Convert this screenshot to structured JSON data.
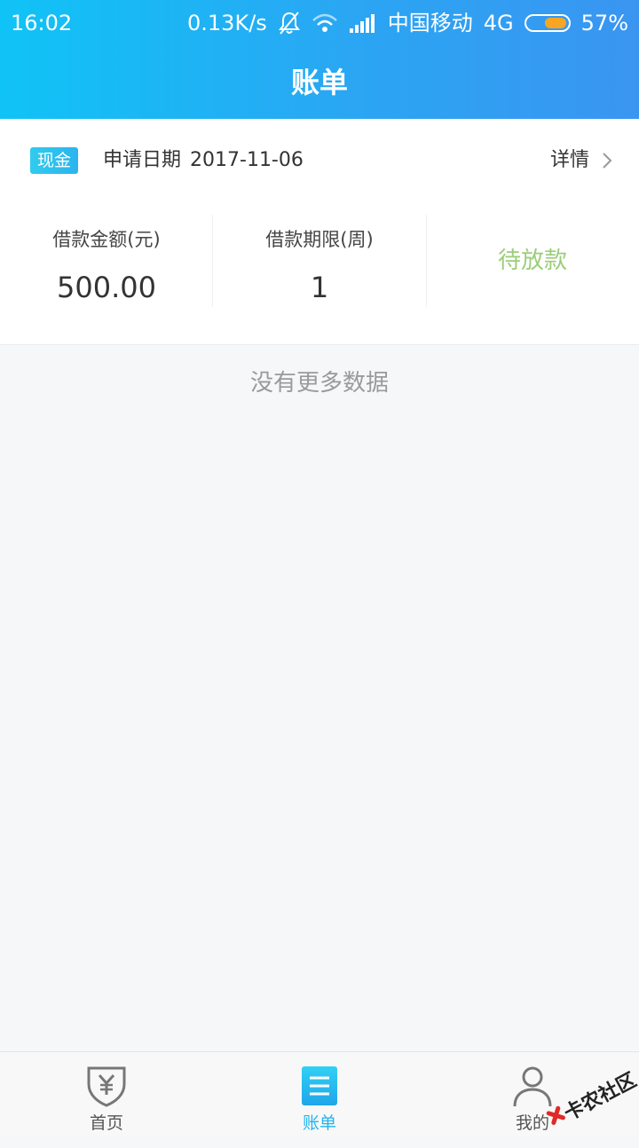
{
  "status_bar": {
    "time": "16:02",
    "net_speed": "0.13K/s",
    "carrier": "中国移动",
    "network": "4G",
    "battery_percent": "57%",
    "battery_level": 0.57,
    "icons": [
      "bell-off-icon",
      "wifi-icon",
      "signal-icon",
      "battery-icon"
    ]
  },
  "header": {
    "title": "账单"
  },
  "bill": {
    "tag": "现金",
    "apply_date_label": "申请日期",
    "apply_date": "2017-11-06",
    "detail_label": "详情",
    "amount_label": "借款金额(元)",
    "amount_value": "500.00",
    "term_label": "借款期限(周)",
    "term_value": "1",
    "status": "待放款"
  },
  "list": {
    "no_more": "没有更多数据"
  },
  "tabbar": {
    "tabs": [
      {
        "label": "首页",
        "icon": "yuan-shield-icon"
      },
      {
        "label": "账单",
        "icon": "bill-list-icon",
        "active": true
      },
      {
        "label": "我的",
        "icon": "user-icon"
      }
    ]
  },
  "watermark": {
    "text": "卡农社区"
  },
  "colors": {
    "header_gradient_start": "#10c3f6",
    "header_gradient_end": "#3a95f1",
    "accent": "#22b4ee",
    "status_green": "#9ccd7a",
    "battery_orange": "#f6a623"
  }
}
